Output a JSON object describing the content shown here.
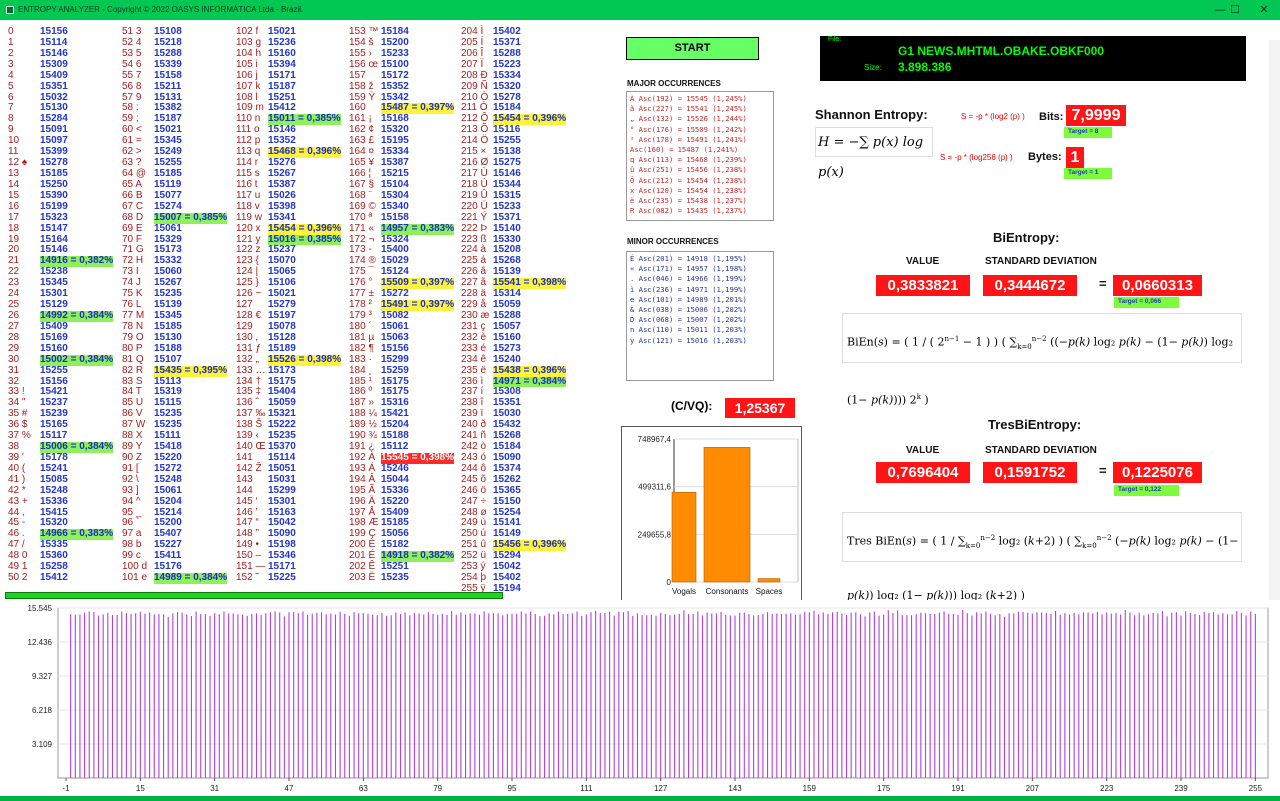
{
  "window": {
    "title": "ENTROPY ANALYZER  - Copyright © 2022 OASYS INFORMÁTICA Ltda - Brazil.",
    "min": "—",
    "max": "☐",
    "close": "✕"
  },
  "start_label": "START",
  "major": {
    "title": "MAJOR OCCURRENCES",
    "items": [
      "À Asc(192) = 15545 (1,245%)",
      "ã Asc(227) = 15541 (1,245%)",
      "„ Asc(132) = 15526 (1,244%)",
      "° Asc(176) = 15509 (1,242%)",
      "² Asc(178) = 15491 (1,241%)",
      "  Asc(160) = 15487 (1,241%)",
      "q Asc(113) = 15468 (1,239%)",
      "û Asc(251) = 15456 (1,238%)",
      "Ô Asc(212) = 15454 (1,238%)",
      "x Asc(120) = 15454 (1,238%)",
      "ë Asc(235) = 15438 (1,237%)",
      "R Asc(082) = 15435 (1,237%)"
    ]
  },
  "minor": {
    "title": "MINOR OCCURRENCES",
    "items": [
      "É Asc(201) = 14918 (1,195%)",
      "« Asc(171) = 14957 (1,198%)",
      ". Asc(046) = 14966 (1,199%)",
      "ì Asc(236) = 14971 (1,199%)",
      "e Asc(101) = 14989 (1,201%)",
      "& Asc(038) = 15006 (1,202%)",
      "D Asc(068) = 15007 (1,202%)",
      "n Asc(110) = 15011 (1,203%)",
      "y Asc(121) = 15016 (1,203%)"
    ]
  },
  "cvq": {
    "label": "(C/VQ):",
    "value": "1,25367"
  },
  "chart_data": {
    "type": "bar",
    "categories": [
      "Vogals",
      "Consonants",
      "Spaces"
    ],
    "values": [
      470000,
      705000,
      18000
    ],
    "ylim": [
      0,
      748967.4
    ],
    "yticks": [
      "748967,4",
      "499311,6",
      "249655,8",
      "0"
    ],
    "colors": [
      "#ff8c00"
    ]
  },
  "file": {
    "label": "File:",
    "name": "G1 NEWS.MHTML.OBAKE.OBKF000",
    "size_label": "Size:",
    "size": "3.898.386"
  },
  "shannon": {
    "title": "Shannon Entropy:",
    "formula_bits": "S = -p * (log2 (p) )",
    "bits_label": "Bits:",
    "bits": "7,9999",
    "bits_target": "Target = 8",
    "formula_bytes": "S = -p * (log256 (p) )",
    "bytes_label": "Bytes:",
    "bytes": "1",
    "bytes_target": "Target = 1"
  },
  "bientropy": {
    "title": "BiEntropy:",
    "value_label": "VALUE",
    "std_label": "STANDARD DEVIATION",
    "value": "0,3833821",
    "std": "0,3444672",
    "eq": "=",
    "result": "0,0660313",
    "target": "Target = 0,066"
  },
  "tres": {
    "title": "TresBiEntropy:",
    "value_label": "VALUE",
    "std_label": "STANDARD DEVIATION",
    "value": "0,7696404",
    "std": "0,1591752",
    "eq": "=",
    "result": "0,1225076",
    "target": "Target = 0,122"
  },
  "bottom": {
    "yticks": [
      "15.545",
      "12.436",
      "9.327",
      "6.218",
      "3.109"
    ],
    "xticks": [
      "-1",
      "15",
      "31",
      "47",
      "63",
      "79",
      "95",
      "111",
      "127",
      "143",
      "159",
      "175",
      "191",
      "207",
      "223",
      "239",
      "255"
    ],
    "color": "#b040e0"
  },
  "ascii": [
    [
      "0",
      "15156",
      ""
    ],
    [
      "1 ",
      "15114",
      ""
    ],
    [
      "2",
      "15146",
      ""
    ],
    [
      "3 ",
      "15309",
      ""
    ],
    [
      "4 ",
      "15409",
      ""
    ],
    [
      "5 ",
      "15351",
      ""
    ],
    [
      "6 ",
      "15032",
      ""
    ],
    [
      "7 ",
      "15130",
      ""
    ],
    [
      "8 ",
      "15284",
      ""
    ],
    [
      "9",
      "15091",
      ""
    ],
    [
      "10",
      "15097",
      ""
    ],
    [
      "11 ",
      "15399",
      ""
    ],
    [
      "12 ♠",
      "15278",
      ""
    ],
    [
      "13",
      "15185",
      ""
    ],
    [
      "14 ",
      "15250",
      ""
    ],
    [
      "15 ",
      "15390",
      ""
    ],
    [
      "16 ",
      "15199",
      ""
    ],
    [
      "17 ",
      "15323",
      ""
    ],
    [
      "18 ",
      "15147",
      ""
    ],
    [
      "19 ",
      "15164",
      ""
    ],
    [
      "20 ",
      "15146",
      ""
    ],
    [
      "21 ",
      "14916 = 0,382%",
      "g"
    ],
    [
      "22 ",
      "15238",
      ""
    ],
    [
      "23 ",
      "15345",
      ""
    ],
    [
      "24 ",
      "15301",
      ""
    ],
    [
      "25 ",
      "15129",
      ""
    ],
    [
      "26 ",
      "14992 = 0,384%",
      "g"
    ],
    [
      "27 ",
      "15409",
      ""
    ],
    [
      "28 ",
      "15169",
      ""
    ],
    [
      "29 ",
      "15160",
      ""
    ],
    [
      "30",
      "15002 = 0,384%",
      "g"
    ],
    [
      "31",
      "15255",
      ""
    ],
    [
      "32",
      "15156",
      ""
    ],
    [
      "33 !",
      "15421",
      ""
    ],
    [
      "34 \"",
      "15237",
      ""
    ],
    [
      "35 #",
      "15239",
      ""
    ],
    [
      "36 $",
      "15165",
      ""
    ],
    [
      "37 %",
      "15117",
      ""
    ],
    [
      "38",
      "15006 = 0,384%",
      "g"
    ],
    [
      "39 '",
      "15178",
      ""
    ],
    [
      "40 (",
      "15241",
      ""
    ],
    [
      "41 )",
      "15085",
      ""
    ],
    [
      "42 *",
      "15248",
      ""
    ],
    [
      "43 +",
      "15336",
      ""
    ],
    [
      "44 ,",
      "15415",
      ""
    ],
    [
      "45 -",
      "15320",
      ""
    ],
    [
      "46 .",
      "14966 = 0,383%",
      "g"
    ],
    [
      "47 /",
      "15335",
      ""
    ],
    [
      "48 0",
      "15360",
      ""
    ],
    [
      "49 1",
      "15258",
      ""
    ],
    [
      "50 2",
      "15412",
      ""
    ],
    [
      "51 3",
      "15108",
      ""
    ],
    [
      "52 4",
      "15218",
      ""
    ],
    [
      "53 5",
      "15288",
      ""
    ],
    [
      "54 6",
      "15339",
      ""
    ],
    [
      "55 7",
      "15158",
      ""
    ],
    [
      "56 8",
      "15211",
      ""
    ],
    [
      "57 9",
      "15131",
      ""
    ],
    [
      "58 :",
      "15382",
      ""
    ],
    [
      "59 ;",
      "15187",
      ""
    ],
    [
      "60 <",
      "15021",
      ""
    ],
    [
      "61 =",
      "15345",
      ""
    ],
    [
      "62 >",
      "15249",
      ""
    ],
    [
      "63 ?",
      "15255",
      ""
    ],
    [
      "64 @",
      "15185",
      ""
    ],
    [
      "65 A",
      "15119",
      ""
    ],
    [
      "66 B",
      "15077",
      ""
    ],
    [
      "67 C",
      "15274",
      ""
    ],
    [
      "68 D",
      "15007 = 0,385%",
      "g"
    ],
    [
      "69 E",
      "15061",
      ""
    ],
    [
      "70 F",
      "15329",
      ""
    ],
    [
      "71 G",
      "15173",
      ""
    ],
    [
      "72 H",
      "15332",
      ""
    ],
    [
      "73 I",
      "15060",
      ""
    ],
    [
      "74 J",
      "15267",
      ""
    ],
    [
      "75 K",
      "15235",
      ""
    ],
    [
      "76 L",
      "15139",
      ""
    ],
    [
      "77 M",
      "15345",
      ""
    ],
    [
      "78 N",
      "15185",
      ""
    ],
    [
      "79 O",
      "15130",
      ""
    ],
    [
      "80 P",
      "15188",
      ""
    ],
    [
      "81 Q",
      "15107",
      ""
    ],
    [
      "82 R",
      "15435 = 0,395%",
      "y"
    ],
    [
      "83 S",
      "15113",
      ""
    ],
    [
      "84 T",
      "15319",
      ""
    ],
    [
      "85 U",
      "15115",
      ""
    ],
    [
      "86 V",
      "15235",
      ""
    ],
    [
      "87 W",
      "15235",
      ""
    ],
    [
      "88 X",
      "15111",
      ""
    ],
    [
      "89 Y",
      "15418",
      ""
    ],
    [
      "90 Z",
      "15220",
      ""
    ],
    [
      "91 [",
      "15272",
      ""
    ],
    [
      "92 \\",
      "15248",
      ""
    ],
    [
      "93 ]",
      "15061",
      ""
    ],
    [
      "94 ^",
      "15204",
      ""
    ],
    [
      "95 _",
      "15214",
      ""
    ],
    [
      "96 `",
      "15200",
      ""
    ],
    [
      "97 a",
      "15407",
      ""
    ],
    [
      "98 b",
      "15227",
      ""
    ],
    [
      "99 c",
      "15411",
      ""
    ],
    [
      "100 d",
      "15176",
      ""
    ],
    [
      "101 e",
      "14989 = 0,384%",
      "g"
    ],
    [
      "102 f",
      "15021",
      ""
    ],
    [
      "103 g",
      "15236",
      ""
    ],
    [
      "104 h",
      "15160",
      ""
    ],
    [
      "105 i",
      "15394",
      ""
    ],
    [
      "106 j",
      "15171",
      ""
    ],
    [
      "107 k",
      "15187",
      ""
    ],
    [
      "108 l",
      "15251",
      ""
    ],
    [
      "109 m",
      "15412",
      ""
    ],
    [
      "110 n",
      "15011 = 0,385%",
      "g"
    ],
    [
      "111 o",
      "15146",
      ""
    ],
    [
      "112 p",
      "15352",
      ""
    ],
    [
      "113 q",
      "15468 = 0,396%",
      "y"
    ],
    [
      "114 r",
      "15276",
      ""
    ],
    [
      "115 s",
      "15267",
      ""
    ],
    [
      "116 t",
      "15387",
      ""
    ],
    [
      "117 u",
      "15026",
      ""
    ],
    [
      "118 v",
      "15398",
      ""
    ],
    [
      "119 w",
      "15341",
      ""
    ],
    [
      "120 x",
      "15454 = 0,396%",
      "y"
    ],
    [
      "121 y",
      "15016 = 0,385%",
      "g"
    ],
    [
      "122 z",
      "15237",
      ""
    ],
    [
      "123 {",
      "15070",
      ""
    ],
    [
      "124 |",
      "15065",
      ""
    ],
    [
      "125 }",
      "15106",
      ""
    ],
    [
      "126 ~",
      "15021",
      ""
    ],
    [
      "127 ",
      "15279",
      ""
    ],
    [
      "128 €",
      "15197",
      ""
    ],
    [
      "129 ",
      "15078",
      ""
    ],
    [
      "130 ‚",
      "15128",
      ""
    ],
    [
      "131 ƒ",
      "15189",
      ""
    ],
    [
      "132 „",
      "15526 = 0,398%",
      "y"
    ],
    [
      "133 …",
      "15173",
      ""
    ],
    [
      "134 †",
      "15175",
      ""
    ],
    [
      "135 ‡",
      "15404",
      ""
    ],
    [
      "136 ˆ",
      "15059",
      ""
    ],
    [
      "137 ‰",
      "15321",
      ""
    ],
    [
      "138 Š",
      "15222",
      ""
    ],
    [
      "139 ‹",
      "15235",
      ""
    ],
    [
      "140 Œ",
      "15370",
      ""
    ],
    [
      "141 ",
      "15114",
      ""
    ],
    [
      "142 Ž",
      "15051",
      ""
    ],
    [
      "143 ",
      "15031",
      ""
    ],
    [
      "144 ",
      "15299",
      ""
    ],
    [
      "145 ‘",
      "15301",
      ""
    ],
    [
      "146 ’",
      "15163",
      ""
    ],
    [
      "147 “",
      "15042",
      ""
    ],
    [
      "148 ”",
      "15090",
      ""
    ],
    [
      "149 •",
      "15198",
      ""
    ],
    [
      "150 –",
      "15346",
      ""
    ],
    [
      "151 —",
      "15171",
      ""
    ],
    [
      "152 ˜",
      "15225",
      ""
    ],
    [
      "153 ™",
      "15184",
      ""
    ],
    [
      "154 š",
      "15200",
      ""
    ],
    [
      "155 ›",
      "15233",
      ""
    ],
    [
      "156 œ",
      "15100",
      ""
    ],
    [
      "157 ",
      "15172",
      ""
    ],
    [
      "158 ž",
      "15352",
      ""
    ],
    [
      "159 Ÿ",
      "15342",
      ""
    ],
    [
      "160",
      "15487 = 0,397%",
      "y"
    ],
    [
      "161 ¡",
      "15168",
      ""
    ],
    [
      "162 ¢",
      "15320",
      ""
    ],
    [
      "163 £",
      "15195",
      ""
    ],
    [
      "164 ¤",
      "15334",
      ""
    ],
    [
      "165 ¥",
      "15387",
      ""
    ],
    [
      "166 ¦",
      "15215",
      ""
    ],
    [
      "167 §",
      "15104",
      ""
    ],
    [
      "168 ¨",
      "15304",
      ""
    ],
    [
      "169 ©",
      "15340",
      ""
    ],
    [
      "170 ª",
      "15158",
      ""
    ],
    [
      "171 «",
      "14957 = 0,383%",
      "g"
    ],
    [
      "172 ¬",
      "15324",
      ""
    ],
    [
      "173 -",
      "15400",
      ""
    ],
    [
      "174 ®",
      "15029",
      ""
    ],
    [
      "175 ¯",
      "15124",
      ""
    ],
    [
      "176 °",
      "15509 = 0,397%",
      "y"
    ],
    [
      "177 ±",
      "15272",
      ""
    ],
    [
      "178 ²",
      "15491 = 0,397%",
      "y"
    ],
    [
      "179 ³",
      "15082",
      ""
    ],
    [
      "180 ´",
      "15061",
      ""
    ],
    [
      "181 µ",
      "15063",
      ""
    ],
    [
      "182 ¶",
      "15156",
      ""
    ],
    [
      "183 ·",
      "15299",
      ""
    ],
    [
      "184 ¸",
      "15259",
      ""
    ],
    [
      "185 ¹",
      "15175",
      ""
    ],
    [
      "186 º",
      "15175",
      ""
    ],
    [
      "187 »",
      "15316",
      ""
    ],
    [
      "188 ¼",
      "15421",
      ""
    ],
    [
      "189 ½",
      "15204",
      ""
    ],
    [
      "190 ¾",
      "15188",
      ""
    ],
    [
      "191 ¿",
      "15112",
      ""
    ],
    [
      "192 À",
      "15545 = 0,398%",
      "r"
    ],
    [
      "193 Á",
      "15246",
      ""
    ],
    [
      "194 Â",
      "15044",
      ""
    ],
    [
      "195 Ã",
      "15336",
      ""
    ],
    [
      "196 Ä",
      "15220",
      ""
    ],
    [
      "197 Å",
      "15409",
      ""
    ],
    [
      "198 Æ",
      "15185",
      ""
    ],
    [
      "199 Ç",
      "15056",
      ""
    ],
    [
      "200 È",
      "15182",
      ""
    ],
    [
      "201 É",
      "14918 = 0,382%",
      "g"
    ],
    [
      "202 Ê",
      "15251",
      ""
    ],
    [
      "203 Ë",
      "15235",
      ""
    ],
    [
      "204 Ì",
      "15402",
      ""
    ],
    [
      "205 Í",
      "15371",
      ""
    ],
    [
      "206 Î",
      "15288",
      ""
    ],
    [
      "207 Ï",
      "15223",
      ""
    ],
    [
      "208 Ð",
      "15334",
      ""
    ],
    [
      "209 Ñ",
      "15320",
      ""
    ],
    [
      "210 Ò",
      "15278",
      ""
    ],
    [
      "211 Ó",
      "15184",
      ""
    ],
    [
      "212 Ô",
      "15454 = 0,396%",
      "y"
    ],
    [
      "213 Õ",
      "15116",
      ""
    ],
    [
      "214 Ö",
      "15255",
      ""
    ],
    [
      "215 ×",
      "15138",
      ""
    ],
    [
      "216 Ø",
      "15275",
      ""
    ],
    [
      "217 Ù",
      "15146",
      ""
    ],
    [
      "218 Ú",
      "15344",
      ""
    ],
    [
      "219 Û",
      "15315",
      ""
    ],
    [
      "220 Ü",
      "15233",
      ""
    ],
    [
      "221 Ý",
      "15371",
      ""
    ],
    [
      "222 Þ",
      "15140",
      ""
    ],
    [
      "223 ß",
      "15330",
      ""
    ],
    [
      "224 à",
      "15208",
      ""
    ],
    [
      "225 á",
      "15268",
      ""
    ],
    [
      "226 â",
      "15139",
      ""
    ],
    [
      "227 ã",
      "15541 = 0,398%",
      "y"
    ],
    [
      "228 ä",
      "15314",
      ""
    ],
    [
      "229 å",
      "15059",
      ""
    ],
    [
      "230 æ",
      "15288",
      ""
    ],
    [
      "231 ç",
      "15057",
      ""
    ],
    [
      "232 è",
      "15160",
      ""
    ],
    [
      "233 é",
      "15273",
      ""
    ],
    [
      "234 ê",
      "15240",
      ""
    ],
    [
      "235 ë",
      "15438 = 0,396%",
      "y"
    ],
    [
      "236 ì",
      "14971 = 0,384%",
      "g"
    ],
    [
      "237 í",
      "15308",
      ""
    ],
    [
      "238 î",
      "15351",
      ""
    ],
    [
      "239 ï",
      "15030",
      ""
    ],
    [
      "240 ð",
      "15432",
      ""
    ],
    [
      "241 ñ",
      "15268",
      ""
    ],
    [
      "242 ò",
      "15184",
      ""
    ],
    [
      "243 ó",
      "15090",
      ""
    ],
    [
      "244 ô",
      "15374",
      ""
    ],
    [
      "245 õ",
      "15262",
      ""
    ],
    [
      "246 ö",
      "15365",
      ""
    ],
    [
      "247 ÷",
      "15150",
      ""
    ],
    [
      "248 ø",
      "15254",
      ""
    ],
    [
      "249 ù",
      "15141",
      ""
    ],
    [
      "250 ú",
      "15149",
      ""
    ],
    [
      "251 û",
      "15456 = 0,396%",
      "y"
    ],
    [
      "252 ü",
      "15294",
      ""
    ],
    [
      "253 ý",
      "15042",
      ""
    ],
    [
      "254 þ",
      "15402",
      ""
    ],
    [
      "255 ÿ",
      "15194",
      ""
    ]
  ]
}
